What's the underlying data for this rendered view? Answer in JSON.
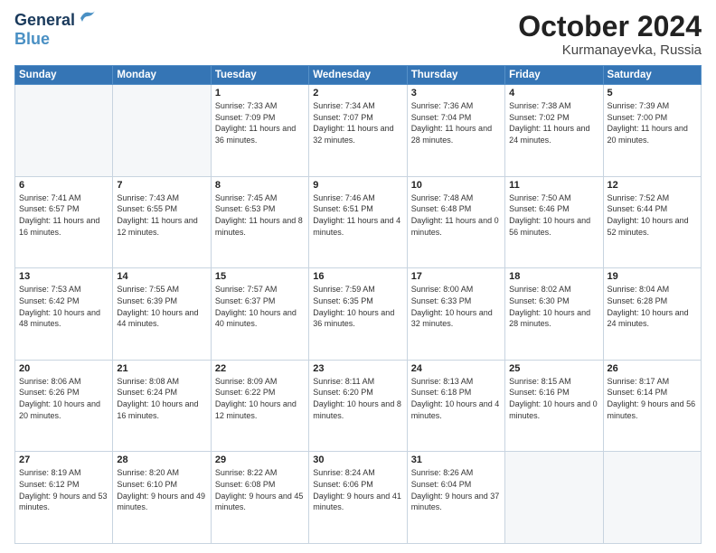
{
  "header": {
    "logo_line1": "General",
    "logo_line2": "Blue",
    "month": "October 2024",
    "location": "Kurmanayevka, Russia"
  },
  "weekdays": [
    "Sunday",
    "Monday",
    "Tuesday",
    "Wednesday",
    "Thursday",
    "Friday",
    "Saturday"
  ],
  "weeks": [
    [
      {
        "day": "",
        "sunrise": "",
        "sunset": "",
        "daylight": ""
      },
      {
        "day": "",
        "sunrise": "",
        "sunset": "",
        "daylight": ""
      },
      {
        "day": "1",
        "sunrise": "Sunrise: 7:33 AM",
        "sunset": "Sunset: 7:09 PM",
        "daylight": "Daylight: 11 hours and 36 minutes."
      },
      {
        "day": "2",
        "sunrise": "Sunrise: 7:34 AM",
        "sunset": "Sunset: 7:07 PM",
        "daylight": "Daylight: 11 hours and 32 minutes."
      },
      {
        "day": "3",
        "sunrise": "Sunrise: 7:36 AM",
        "sunset": "Sunset: 7:04 PM",
        "daylight": "Daylight: 11 hours and 28 minutes."
      },
      {
        "day": "4",
        "sunrise": "Sunrise: 7:38 AM",
        "sunset": "Sunset: 7:02 PM",
        "daylight": "Daylight: 11 hours and 24 minutes."
      },
      {
        "day": "5",
        "sunrise": "Sunrise: 7:39 AM",
        "sunset": "Sunset: 7:00 PM",
        "daylight": "Daylight: 11 hours and 20 minutes."
      }
    ],
    [
      {
        "day": "6",
        "sunrise": "Sunrise: 7:41 AM",
        "sunset": "Sunset: 6:57 PM",
        "daylight": "Daylight: 11 hours and 16 minutes."
      },
      {
        "day": "7",
        "sunrise": "Sunrise: 7:43 AM",
        "sunset": "Sunset: 6:55 PM",
        "daylight": "Daylight: 11 hours and 12 minutes."
      },
      {
        "day": "8",
        "sunrise": "Sunrise: 7:45 AM",
        "sunset": "Sunset: 6:53 PM",
        "daylight": "Daylight: 11 hours and 8 minutes."
      },
      {
        "day": "9",
        "sunrise": "Sunrise: 7:46 AM",
        "sunset": "Sunset: 6:51 PM",
        "daylight": "Daylight: 11 hours and 4 minutes."
      },
      {
        "day": "10",
        "sunrise": "Sunrise: 7:48 AM",
        "sunset": "Sunset: 6:48 PM",
        "daylight": "Daylight: 11 hours and 0 minutes."
      },
      {
        "day": "11",
        "sunrise": "Sunrise: 7:50 AM",
        "sunset": "Sunset: 6:46 PM",
        "daylight": "Daylight: 10 hours and 56 minutes."
      },
      {
        "day": "12",
        "sunrise": "Sunrise: 7:52 AM",
        "sunset": "Sunset: 6:44 PM",
        "daylight": "Daylight: 10 hours and 52 minutes."
      }
    ],
    [
      {
        "day": "13",
        "sunrise": "Sunrise: 7:53 AM",
        "sunset": "Sunset: 6:42 PM",
        "daylight": "Daylight: 10 hours and 48 minutes."
      },
      {
        "day": "14",
        "sunrise": "Sunrise: 7:55 AM",
        "sunset": "Sunset: 6:39 PM",
        "daylight": "Daylight: 10 hours and 44 minutes."
      },
      {
        "day": "15",
        "sunrise": "Sunrise: 7:57 AM",
        "sunset": "Sunset: 6:37 PM",
        "daylight": "Daylight: 10 hours and 40 minutes."
      },
      {
        "day": "16",
        "sunrise": "Sunrise: 7:59 AM",
        "sunset": "Sunset: 6:35 PM",
        "daylight": "Daylight: 10 hours and 36 minutes."
      },
      {
        "day": "17",
        "sunrise": "Sunrise: 8:00 AM",
        "sunset": "Sunset: 6:33 PM",
        "daylight": "Daylight: 10 hours and 32 minutes."
      },
      {
        "day": "18",
        "sunrise": "Sunrise: 8:02 AM",
        "sunset": "Sunset: 6:30 PM",
        "daylight": "Daylight: 10 hours and 28 minutes."
      },
      {
        "day": "19",
        "sunrise": "Sunrise: 8:04 AM",
        "sunset": "Sunset: 6:28 PM",
        "daylight": "Daylight: 10 hours and 24 minutes."
      }
    ],
    [
      {
        "day": "20",
        "sunrise": "Sunrise: 8:06 AM",
        "sunset": "Sunset: 6:26 PM",
        "daylight": "Daylight: 10 hours and 20 minutes."
      },
      {
        "day": "21",
        "sunrise": "Sunrise: 8:08 AM",
        "sunset": "Sunset: 6:24 PM",
        "daylight": "Daylight: 10 hours and 16 minutes."
      },
      {
        "day": "22",
        "sunrise": "Sunrise: 8:09 AM",
        "sunset": "Sunset: 6:22 PM",
        "daylight": "Daylight: 10 hours and 12 minutes."
      },
      {
        "day": "23",
        "sunrise": "Sunrise: 8:11 AM",
        "sunset": "Sunset: 6:20 PM",
        "daylight": "Daylight: 10 hours and 8 minutes."
      },
      {
        "day": "24",
        "sunrise": "Sunrise: 8:13 AM",
        "sunset": "Sunset: 6:18 PM",
        "daylight": "Daylight: 10 hours and 4 minutes."
      },
      {
        "day": "25",
        "sunrise": "Sunrise: 8:15 AM",
        "sunset": "Sunset: 6:16 PM",
        "daylight": "Daylight: 10 hours and 0 minutes."
      },
      {
        "day": "26",
        "sunrise": "Sunrise: 8:17 AM",
        "sunset": "Sunset: 6:14 PM",
        "daylight": "Daylight: 9 hours and 56 minutes."
      }
    ],
    [
      {
        "day": "27",
        "sunrise": "Sunrise: 8:19 AM",
        "sunset": "Sunset: 6:12 PM",
        "daylight": "Daylight: 9 hours and 53 minutes."
      },
      {
        "day": "28",
        "sunrise": "Sunrise: 8:20 AM",
        "sunset": "Sunset: 6:10 PM",
        "daylight": "Daylight: 9 hours and 49 minutes."
      },
      {
        "day": "29",
        "sunrise": "Sunrise: 8:22 AM",
        "sunset": "Sunset: 6:08 PM",
        "daylight": "Daylight: 9 hours and 45 minutes."
      },
      {
        "day": "30",
        "sunrise": "Sunrise: 8:24 AM",
        "sunset": "Sunset: 6:06 PM",
        "daylight": "Daylight: 9 hours and 41 minutes."
      },
      {
        "day": "31",
        "sunrise": "Sunrise: 8:26 AM",
        "sunset": "Sunset: 6:04 PM",
        "daylight": "Daylight: 9 hours and 37 minutes."
      },
      {
        "day": "",
        "sunrise": "",
        "sunset": "",
        "daylight": ""
      },
      {
        "day": "",
        "sunrise": "",
        "sunset": "",
        "daylight": ""
      }
    ]
  ]
}
